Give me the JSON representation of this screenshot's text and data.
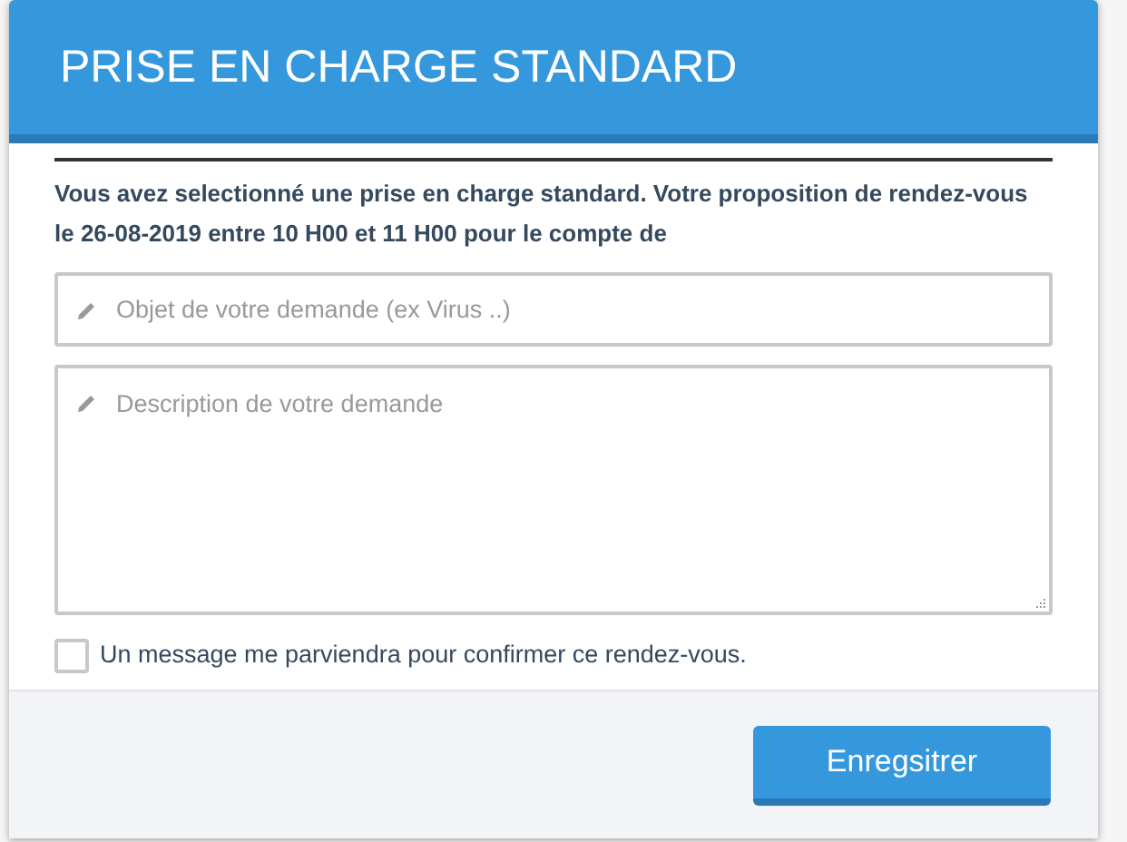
{
  "dialog": {
    "title": "PRISE EN CHARGE STANDARD",
    "message": "Vous avez selectionné une prise en charge standard. Votre proposition de rendez-vous le 26-08-2019 entre 10 H00 et 11 H00 pour le compte de",
    "subject_field": {
      "placeholder": "Objet de votre demande (ex Virus ..)"
    },
    "description_field": {
      "placeholder": "Description de votre demande"
    },
    "confirmation": {
      "label": "Un message me parviendra pour confirmer ce rendez-vous.",
      "checked": false
    },
    "buttons": [
      "Enregsitrer"
    ]
  }
}
